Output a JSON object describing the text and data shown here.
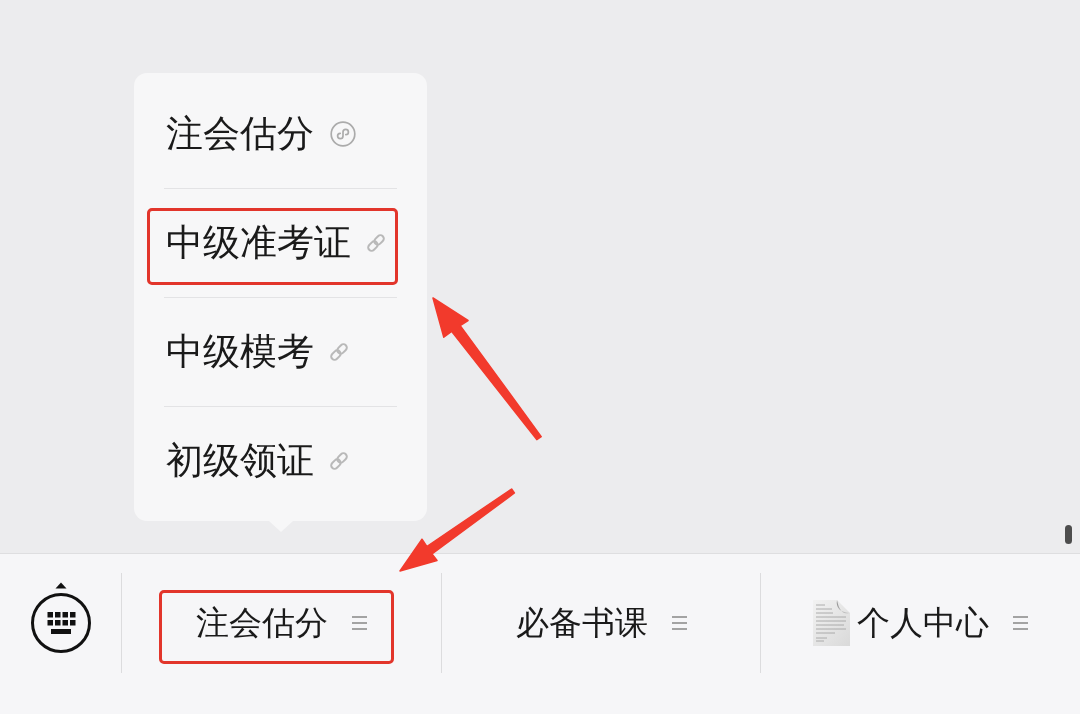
{
  "menu_bar": {
    "tabs": [
      {
        "label": "注会估分",
        "has_submenu": true,
        "leading_icon": false,
        "highlighted": true,
        "expanded": true,
        "submenu": [
          {
            "label": "注会估分",
            "kind": "miniprogram",
            "highlighted": false
          },
          {
            "label": "中级准考证",
            "kind": "link",
            "highlighted": true
          },
          {
            "label": "中级模考",
            "kind": "link",
            "highlighted": false
          },
          {
            "label": "初级领证",
            "kind": "link",
            "highlighted": false
          }
        ]
      },
      {
        "label": "必备书课",
        "has_submenu": true,
        "leading_icon": false,
        "highlighted": false,
        "expanded": false
      },
      {
        "label": "个人中心",
        "has_submenu": true,
        "leading_icon": true,
        "highlighted": false,
        "expanded": false
      }
    ]
  }
}
